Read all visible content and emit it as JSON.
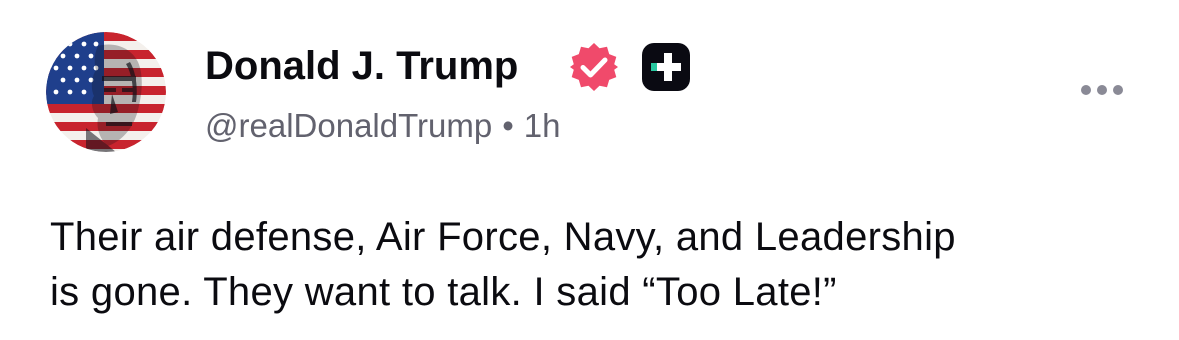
{
  "author": {
    "display_name": "Donald J. Trump",
    "handle": "@realDonaldTrump",
    "separator": "•",
    "time_ago": "1h",
    "avatar_icon": "flag-portrait-avatar",
    "verified_icon": "verified-badge-icon",
    "verified_color": "#f04a6b",
    "plus_badge_icon": "plus-badge-icon",
    "plus_badge_bg": "#0a0a12",
    "plus_badge_accent": "#28c8a0"
  },
  "post": {
    "lines": [
      "Their air defense, Air Force, Navy, and Leadership",
      "is gone. They want to talk. I said “Too Late!”"
    ]
  },
  "actions": {
    "more_icon": "more-horizontal-icon"
  }
}
